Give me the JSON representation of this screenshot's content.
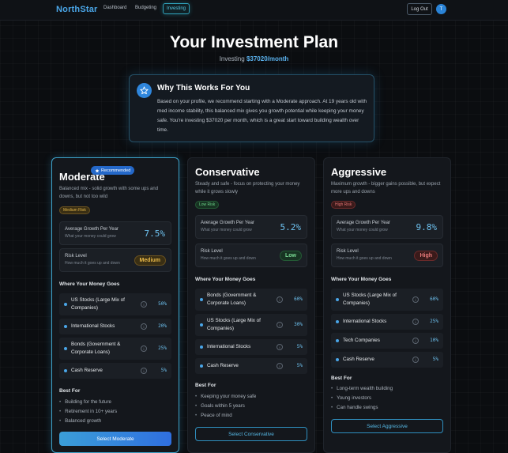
{
  "nav": {
    "brand": "NorthStar",
    "links": [
      "Dashboard",
      "Budgeting",
      "Investing"
    ],
    "logout": "Log Out",
    "avatar": "T"
  },
  "hero": {
    "title": "Your Investment Plan",
    "subtitle_prefix": "Investing",
    "subtitle_amount": "$37020/month"
  },
  "why": {
    "icon": "star-icon",
    "title": "Why This Works For You",
    "body": "Based on your profile, we recommend starting with a Moderate approach. At 19 years old with med income stability, this balanced mix gives you growth potential while keeping your money safe. You're investing $37020 per month, which is a great start toward building wealth over time."
  },
  "common": {
    "growth_label": "Average Growth Per Year",
    "growth_sub": "What your money could grow",
    "risk_label": "Risk Level",
    "risk_sub": "How much it goes up and down",
    "alloc_heading": "Where Your Money Goes",
    "best_heading": "Best For",
    "info_glyph": "i"
  },
  "plans": {
    "moderate": {
      "badge": "Recommended",
      "title": "Moderate",
      "desc": "Balanced mix - solid growth with some ups and downs, but not too wild",
      "tag": "Medium Risk",
      "growth": "7.5%",
      "risk": "Medium",
      "allocations": [
        {
          "name": "US Stocks (Large Mix of Companies)",
          "pct": "50%"
        },
        {
          "name": "International Stocks",
          "pct": "20%"
        },
        {
          "name": "Bonds (Government & Corporate Loans)",
          "pct": "25%"
        },
        {
          "name": "Cash Reserve",
          "pct": "5%"
        }
      ],
      "best_for": [
        "Building for the future",
        "Retirement in 10+ years",
        "Balanced growth"
      ],
      "button": "Select Moderate"
    },
    "conservative": {
      "title": "Conservative",
      "desc": "Steady and safe - focus on protecting your money while it grows slowly",
      "tag": "Low Risk",
      "growth": "5.2%",
      "risk": "Low",
      "allocations": [
        {
          "name": "Bonds (Government & Corporate Loans)",
          "pct": "60%"
        },
        {
          "name": "US Stocks (Large Mix of Companies)",
          "pct": "30%"
        },
        {
          "name": "International Stocks",
          "pct": "5%"
        },
        {
          "name": "Cash Reserve",
          "pct": "5%"
        }
      ],
      "best_for": [
        "Keeping your money safe",
        "Goals within 5 years",
        "Peace of mind"
      ],
      "button": "Select Conservative"
    },
    "aggressive": {
      "title": "Aggressive",
      "desc": "Maximum growth - bigger gains possible, but expect more ups and downs",
      "tag": "High Risk",
      "growth": "9.8%",
      "risk": "High",
      "allocations": [
        {
          "name": "US Stocks (Large Mix of Companies)",
          "pct": "60%"
        },
        {
          "name": "International Stocks",
          "pct": "25%"
        },
        {
          "name": "Tech Companies",
          "pct": "10%"
        },
        {
          "name": "Cash Reserve",
          "pct": "5%"
        }
      ],
      "best_for": [
        "Long-term wealth building",
        "Young investors",
        "Can handle swings"
      ],
      "button": "Select Aggressive"
    }
  }
}
